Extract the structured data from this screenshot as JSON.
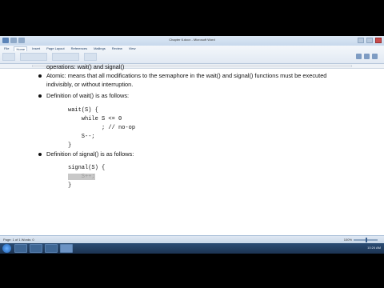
{
  "window": {
    "title": "Chapter 6.docx - Microsoft Word"
  },
  "ribbon": {
    "tabs": [
      "File",
      "Home",
      "Insert",
      "Page Layout",
      "References",
      "Mailings",
      "Review",
      "View"
    ]
  },
  "document": {
    "line_operations": "operations: wait() and signal()",
    "bullet_atomic_1": "Atomic: means that all modifications to the semaphore in the wait() and signal() functions must be executed",
    "bullet_atomic_2": "indivisibly, or without interruption.",
    "bullet_wait_def": "Definition of wait() is as follows:",
    "wait_code": [
      "wait(S) {",
      "    while S <= 0",
      "          ; // no-op",
      "    S--;",
      "}"
    ],
    "bullet_signal_def": "Definition of signal() is as follows:",
    "signal_code": [
      "signal(S) {",
      "    S++;",
      "}"
    ]
  },
  "statusbar": {
    "page_info": "Page: 1 of 1   Words: 0",
    "zoom": "100%",
    "zoom_level": 0.5
  },
  "taskbar": {
    "clock": "10:24 AM"
  }
}
